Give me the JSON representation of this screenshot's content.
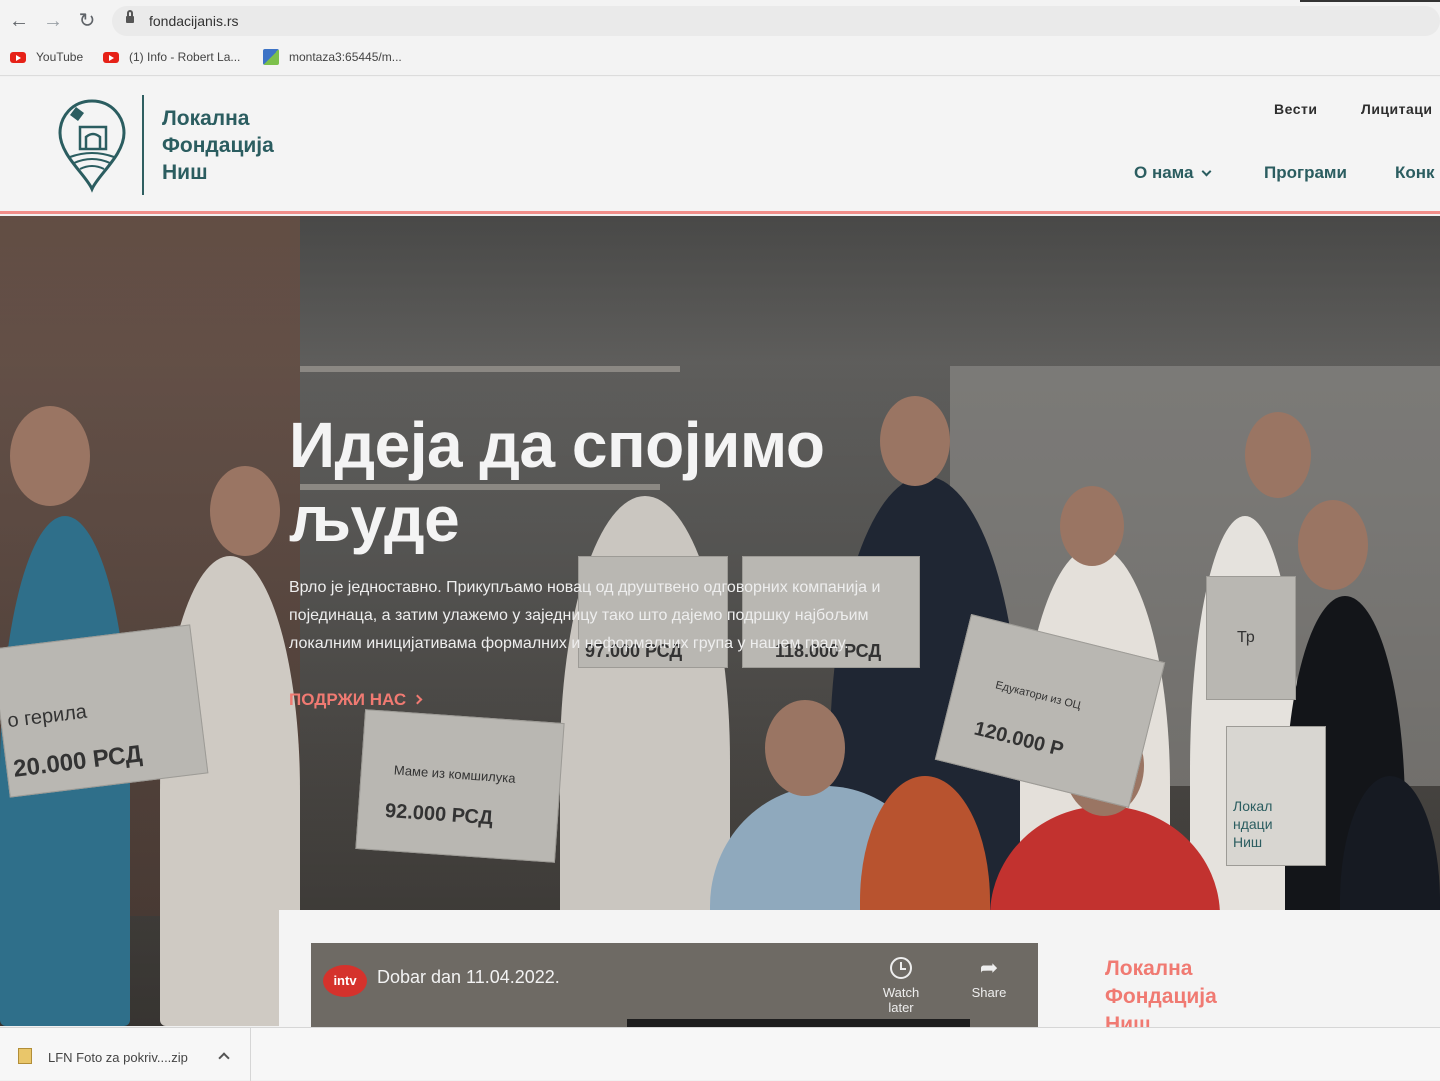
{
  "browser": {
    "url": "fondacijanis.rs",
    "bookmarks": [
      {
        "label": "YouTube",
        "icon": "youtube-icon"
      },
      {
        "label": "(1) Info - Robert La...",
        "icon": "youtube-icon"
      },
      {
        "label": "montaza3:65445/m...",
        "icon": "puzzle-icon"
      }
    ]
  },
  "header": {
    "logo_line1": "Локална",
    "logo_line2": "Фондација",
    "logo_line3": "Ниш",
    "top_links": [
      "Вести",
      "Лицитаци"
    ],
    "nav": [
      "О нама",
      "Програми",
      "Конк"
    ]
  },
  "hero": {
    "title_line1": "Идеја да спојимо",
    "title_line2": "људе",
    "text_line1": "Врло је једноставно. Прикупљамо новац од друштвено одговорних компанија и",
    "text_line2": "појединаца, а затим улажемо у заједницу тако што дајемо подршку најбољим",
    "text_line3": "локалним иницијативама формалних и неформалних група у нашем граду.",
    "cta": "ПОДРЖИ НАС",
    "sign_texts": [
      "о герила",
      "20.000 РСД",
      "Маме из комшилука",
      "92.000 РСД",
      "97.000 РСД",
      "118.000 РСД",
      "Едукатори из ОЦ",
      "120.000 Р",
      "Тр",
      "Локал",
      "ндаци",
      "Ниш"
    ]
  },
  "video": {
    "channel_logo": "intv",
    "title": "Dobar dan 11.04.2022.",
    "watch_later": "Watch later",
    "share": "Share"
  },
  "card_brand": {
    "line1": "Локална",
    "line2": "Фондација",
    "line3": "Ниш"
  },
  "download": {
    "file_name": "LFN Foto za pokriv....zip"
  },
  "colors": {
    "brand_teal": "#2b5d60",
    "accent_coral": "#f07a72",
    "header_border": "#f08d89"
  }
}
